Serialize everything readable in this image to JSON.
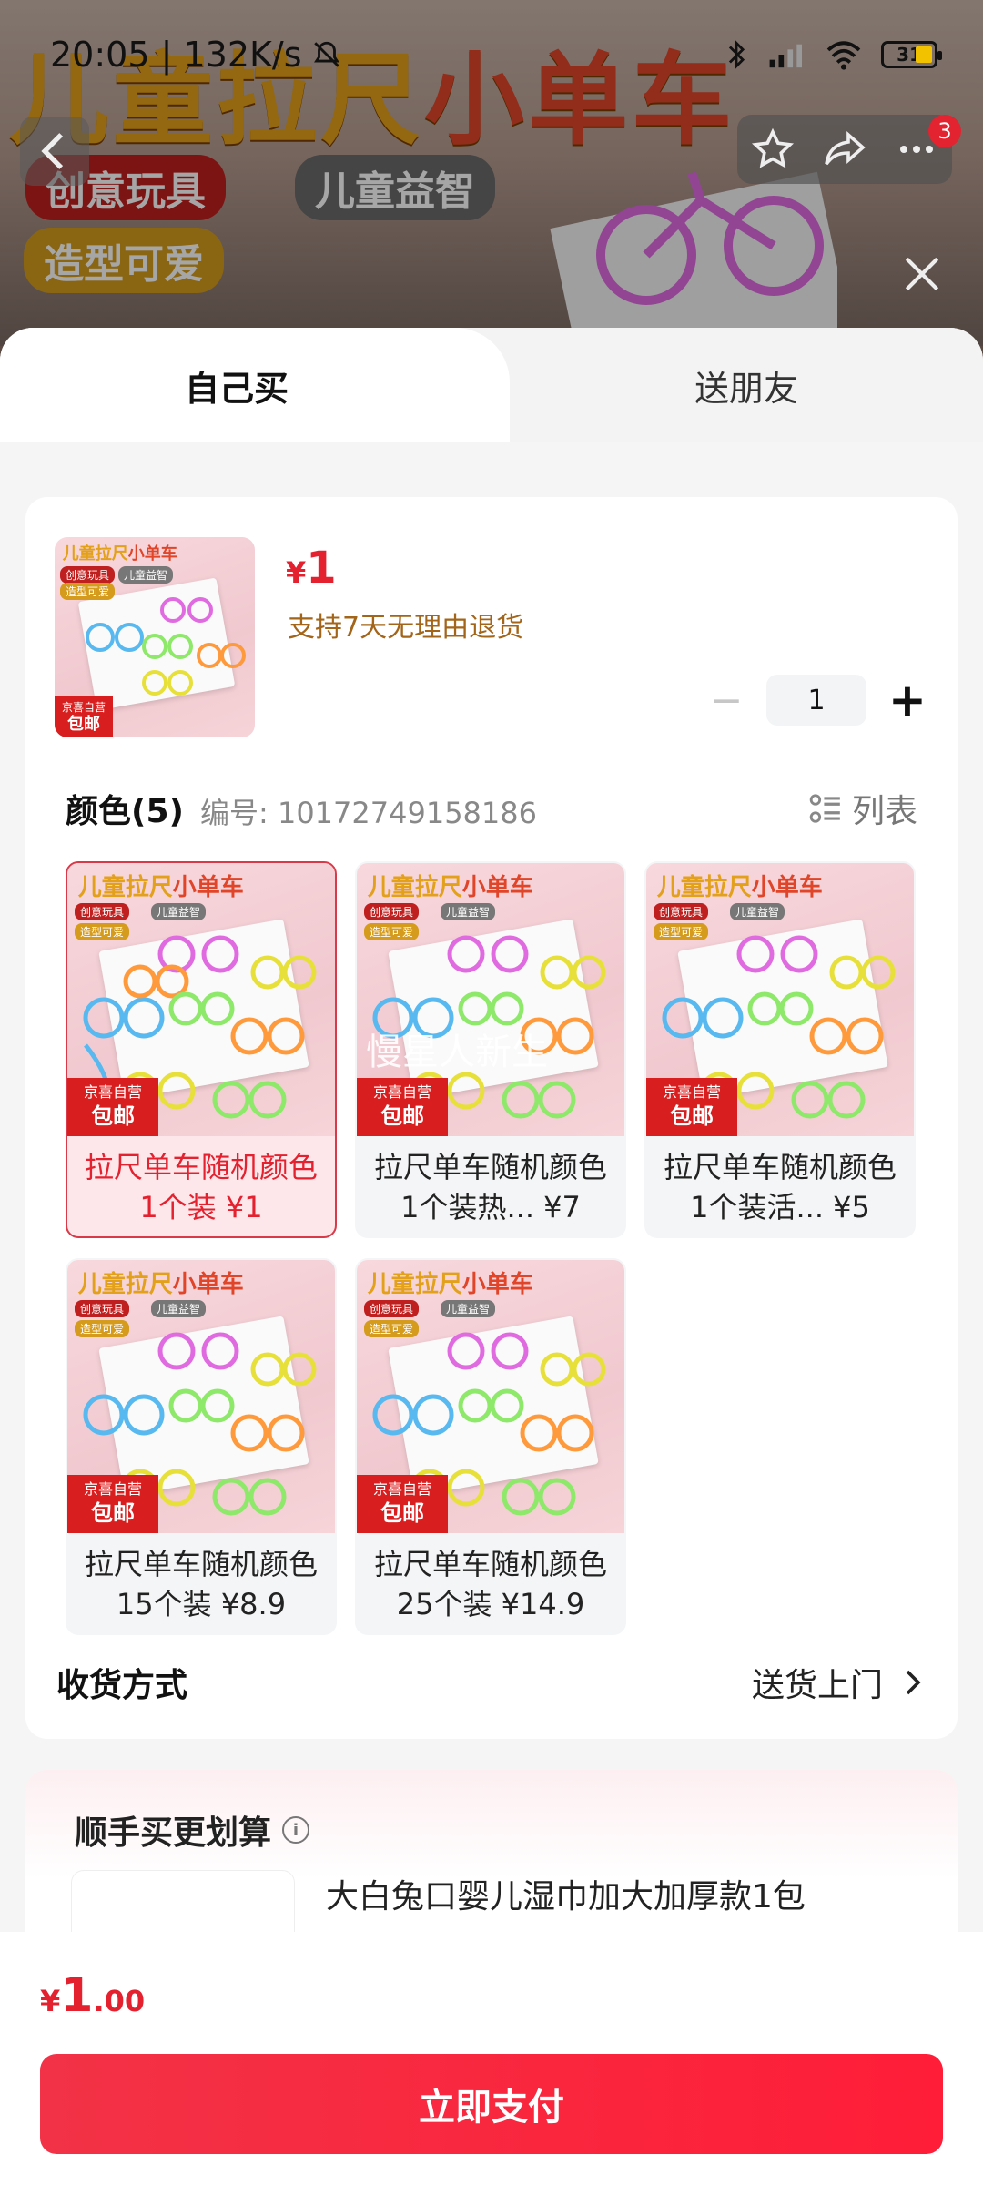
{
  "status_bar": {
    "time_speed": "20:05 | 132K/s",
    "battery": "31"
  },
  "banner": {
    "title_a": "儿童拉尺",
    "title_b": "小单车",
    "tags": [
      "创意玩具",
      "儿童益智",
      "造型可爱"
    ],
    "badge_count": "3"
  },
  "tabs": {
    "self": "自己买",
    "friend": "送朋友"
  },
  "product": {
    "currency": "¥",
    "price": "1",
    "return_note": "支持7天无理由退货",
    "quantity": "1"
  },
  "thumb_art": {
    "title_a": "儿童拉尺",
    "title_b": "小单车",
    "chip1": "创意玩具",
    "chip2": "儿童益智",
    "chip3": "造型可爱",
    "promo_top": "京喜自营",
    "promo_bottom": "包邮",
    "watermark": "慢星人新生"
  },
  "colors": {
    "heading": "颜色(5)",
    "sku": "编号: 10172749158186",
    "list_label": "列表",
    "items": [
      {
        "line1": "拉尺单车随机颜色",
        "line2": "1个装 ¥1"
      },
      {
        "line1": "拉尺单车随机颜色",
        "line2": "1个装热... ¥7"
      },
      {
        "line1": "拉尺单车随机颜色",
        "line2": "1个装活... ¥5"
      },
      {
        "line1": "拉尺单车随机颜色",
        "line2": "15个装 ¥8.9"
      },
      {
        "line1": "拉尺单车随机颜色",
        "line2": "25个装 ¥14.9"
      }
    ]
  },
  "delivery": {
    "label": "收货方式",
    "value": "送货上门"
  },
  "addon": {
    "title": "顺手买更划算",
    "product_name": "大白兔口婴儿湿巾加大加厚款1包"
  },
  "footer": {
    "currency": "¥",
    "total_int": "1",
    "total_dec": ".00",
    "pay_label": "立即支付"
  },
  "colors_theme": {
    "accent": "#e4212f",
    "return_note": "#a3651a"
  }
}
